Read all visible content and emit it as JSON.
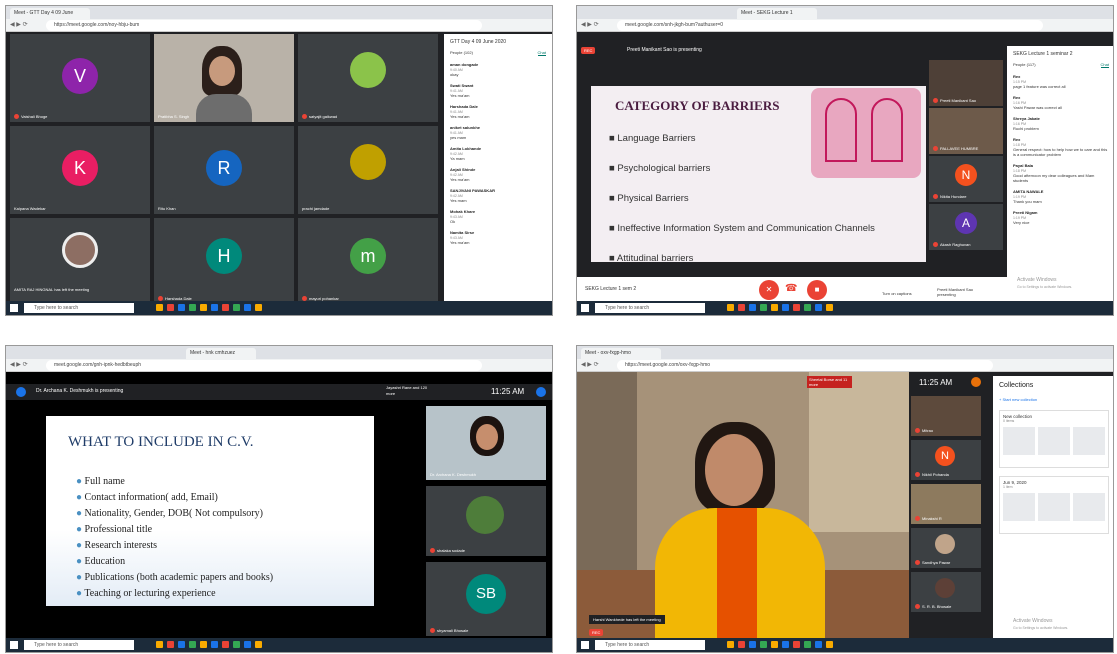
{
  "tl": {
    "tab": "Meet - GTT Day 4 09 June",
    "url": "https://meet.google.com/noy-hbju-bum",
    "tiles": [
      {
        "letter": "V",
        "color": "#8e24aa",
        "name": "Vaishali Bhoge"
      },
      {
        "name": "Pratibha S. Singh"
      },
      {
        "name": "satyajit gaikwad"
      },
      {
        "letter": "K",
        "color": "#e91e63",
        "name": "Kalpana Wadekar"
      },
      {
        "letter": "R",
        "color": "#1565c0",
        "name": "Ritu Khan"
      },
      {
        "name": "prachi jamdade"
      },
      {
        "name": "AMITA RAJ HINGNAL has left the meeting"
      },
      {
        "letter": "H",
        "color": "#00897b",
        "name": "Harshada Dale"
      },
      {
        "letter": "m",
        "color": "#43a047",
        "name": "mayuri pohankar"
      }
    ],
    "rec": "REC",
    "panel_title": "GTT Day 4 09 June 2020",
    "people_tab": "People (102)",
    "chat_tab": "Chat",
    "chat": [
      {
        "n": "aman dongade",
        "t": "9:40 AM",
        "m": "okay"
      },
      {
        "n": "Swati Swant",
        "t": "9:41 AM",
        "m": "Yes ma'am"
      },
      {
        "n": "Harshada Dale",
        "t": "9:41 AM",
        "m": "Yes ma'am"
      },
      {
        "n": "aniket salunkhe",
        "t": "9:41 AM",
        "m": "yes mam"
      },
      {
        "n": "Amita Lokhande",
        "t": "9:42 AM",
        "m": "Ya mam"
      },
      {
        "n": "Anjali Shinde",
        "t": "9:42 AM",
        "m": "Yes ma'am"
      },
      {
        "n": "SANJIVANI PAWASKAR",
        "t": "9:42 AM",
        "m": "Yes mam"
      },
      {
        "n": "Mohak Khare",
        "t": "9:43 AM",
        "m": "Ok"
      },
      {
        "n": "Namita Sirse",
        "t": "9:43 AM",
        "m": "Yes ma'am"
      }
    ],
    "search": "Type here to search"
  },
  "tr": {
    "tab": "Meet - SEKG Lecture 1",
    "url": "meet.google.com/snh-jkgh-bum?authuser=0",
    "presenter": "Preeti Manikant Sao is presenting",
    "rec": "REC",
    "slide": {
      "title": "CATEGORY OF BARRIERS",
      "items": [
        "Language Barriers",
        "Psychological barriers",
        "Physical Barriers",
        "Ineffective Information System and Communication Channels",
        "Attitudinal barriers"
      ]
    },
    "side": [
      {
        "name": "Preeti Manikant Sao"
      },
      {
        "name": "PALLAVEE HUMBRE"
      },
      {
        "letter": "N",
        "color": "#f4511e",
        "name": "Nikita Hundare"
      },
      {
        "letter": "A",
        "color": "#5e35b1",
        "name": "Akash Raghuvan"
      }
    ],
    "panel_title": "SEKG Lecture 1 seminar 2",
    "people_tab": "People (117)",
    "chat_tab": "Chat",
    "chat": [
      {
        "n": "Rex",
        "t": "1:15 PM",
        "m": "page 1 feature was correct all"
      },
      {
        "n": "Rex",
        "t": "1:16 PM",
        "m": "Yashi Pawar was correct all"
      },
      {
        "n": "Shreya Jakate",
        "t": "1:16 PM",
        "m": "Ruchi problem"
      },
      {
        "n": "Rex",
        "t": "1:18 PM",
        "m": "General respect: how to help how we to care and this is a communicator problem"
      },
      {
        "n": "Payal Bala",
        "t": "1:18 PM",
        "m": "Good afternoon my dear colleagues and Mam students"
      },
      {
        "n": "AMITA NAWALE",
        "t": "1:19 PM",
        "m": "Thank you mam"
      },
      {
        "n": "Preeti Nigam",
        "t": "1:19 PM",
        "m": "Very nice"
      }
    ],
    "activate": "Activate Windows",
    "activate_sub": "Go to Settings to activate Windows.",
    "meeting_details": "SEKG Lecture 1 sem 2",
    "btn_captions": "Turn on captions",
    "btn_present": "Preeti Manikant Sao presenting",
    "search": "Type here to search"
  },
  "bl": {
    "tab": "Meet - hnk cmhzuez",
    "url": "meet.google.com/gnh-ipnk-hedbtbeuph",
    "presenter": "Dr. Archana K. Deshmukh is presenting",
    "others": "Jayashri Rane and 120 more",
    "time": "11:25 AM",
    "slide": {
      "title": "WHAT TO INCLUDE IN C.V.",
      "items": [
        "Full name",
        "Contact information( add, Email)",
        "Nationality, Gender, DOB( Not compulsory)",
        "Professional title",
        "Research interests",
        "Education",
        "Publications (both academic papers and books)",
        "Teaching or lecturing experience"
      ]
    },
    "side": [
      {
        "name": "Dr. Archana K. Deshmukh"
      },
      {
        "name": "shalaka sodade"
      },
      {
        "letter": "SB",
        "color": "#00897b",
        "name": "shyamali Bhosale"
      }
    ],
    "search": "Type here to search"
  },
  "br": {
    "tab": "Meet - oxv-fxgp-hmo",
    "url": "https://meet.google.com/oxv-fxgp-hmo",
    "others": "Sheetal Borse and 11 more",
    "time": "11:25 AM",
    "collections_title": "Collections",
    "new_collection": "Start new collection",
    "collections": [
      {
        "t": "New collection",
        "s": "0 items"
      },
      {
        "t": "Jun 9, 2020",
        "s": "1 item"
      }
    ],
    "side": [
      {
        "name": "Mitrao"
      },
      {
        "letter": "N",
        "color": "#f4511e",
        "name": "Nikhil Pohanda"
      },
      {
        "name": "Minakshi R"
      },
      {
        "name": "Sandhya Pawar"
      },
      {
        "name": "S. R. B. Bhosale"
      }
    ],
    "left_msg": "Harshi Wankhede has left the meeting",
    "rec": "REC",
    "activate": "Activate Windows",
    "activate_sub": "Go to Settings to activate Windows.",
    "search": "Type here to search"
  }
}
